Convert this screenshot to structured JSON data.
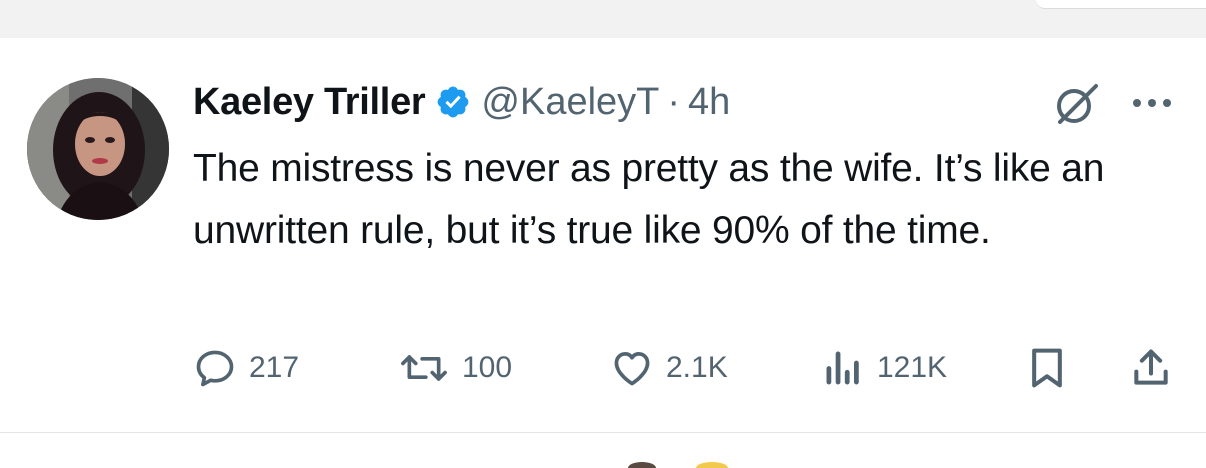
{
  "tweet": {
    "author_name": "Kaeley Triller",
    "handle": "@KaeleyT",
    "separator": "·",
    "time": "4h",
    "text": "The mistress is never as pretty as the wife. It’s like an unwritten rule, but it’s true like 90% of the time.",
    "icons": {
      "avatar": "avatar",
      "verified": "verified-badge-icon",
      "grok": "grok-icon",
      "more": "more-icon"
    }
  },
  "actions": {
    "reply": {
      "icon": "reply-icon",
      "count": "217"
    },
    "retweet": {
      "icon": "retweet-icon",
      "count": "100"
    },
    "like": {
      "icon": "like-icon",
      "count": "2.1K"
    },
    "views": {
      "icon": "views-icon",
      "count": "121K"
    },
    "bookmark": {
      "icon": "bookmark-icon"
    },
    "share": {
      "icon": "share-icon"
    }
  },
  "colors": {
    "text": "#0f1419",
    "secondary": "#536471",
    "verified_blue": "#1d9bf0",
    "background": "#ffffff",
    "top_strip": "#f2f2f2"
  }
}
